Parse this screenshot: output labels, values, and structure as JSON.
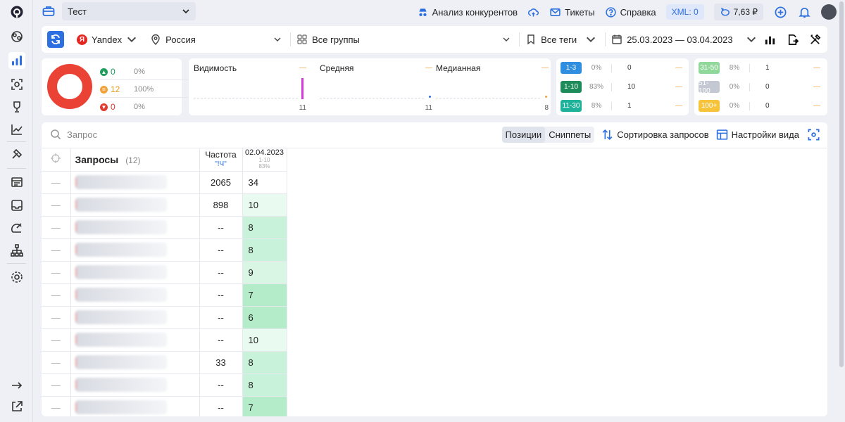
{
  "topbar": {
    "project": "Тест",
    "links": {
      "competitors": "Анализ конкурентов",
      "tickets": "Тикеты",
      "help": "Справка"
    },
    "xml": "XML: 0",
    "balance": "7,63 ₽"
  },
  "filters": {
    "engine": "Yandex",
    "region": "Россия",
    "groups": "Все группы",
    "tags": "Все теги",
    "date_range": "25.03.2023 — 03.04.2023"
  },
  "summary": {
    "up": {
      "count": "0",
      "pct": "0%"
    },
    "same": {
      "count": "12",
      "pct": "100%"
    },
    "down": {
      "count": "0",
      "pct": "0%"
    }
  },
  "metrics": [
    {
      "title": "Видимость",
      "delta": "—",
      "value": "11"
    },
    {
      "title": "Средняя",
      "delta": "—",
      "value": "11"
    },
    {
      "title": "Медианная",
      "delta": "—",
      "value": "8"
    }
  ],
  "ranges_left": [
    {
      "label": "1-3",
      "pct": "0%",
      "count": "0",
      "delta": "—",
      "color": "#2f8ee0"
    },
    {
      "label": "1-10",
      "pct": "83%",
      "count": "10",
      "delta": "—",
      "color": "#1d8c5a"
    },
    {
      "label": "11-30",
      "pct": "8%",
      "count": "1",
      "delta": "—",
      "color": "#1fb29a"
    }
  ],
  "ranges_right": [
    {
      "label": "31-50",
      "pct": "8%",
      "count": "1",
      "delta": "—",
      "color": "#8fd89a"
    },
    {
      "label": "51-100",
      "pct": "0%",
      "count": "0",
      "delta": "—",
      "color": "#c3c8d2"
    },
    {
      "label": "100+",
      "pct": "0%",
      "count": "0",
      "delta": "—",
      "color": "#f6c33b"
    }
  ],
  "main": {
    "search_placeholder": "Запрос",
    "seg_positions": "Позиции",
    "seg_snippets": "Сниппеты",
    "sort": "Сортировка запросов",
    "view": "Настройки вида",
    "col_queries": "Запросы",
    "query_count": "(12)",
    "col_freq": "Частота",
    "col_freq_sub": "\"!Ч\"",
    "col_date": "02.04.2023",
    "col_date_range": "1-10",
    "col_date_pct": "83%",
    "rows": [
      {
        "dash": "—",
        "freq": "2065",
        "pos": "34"
      },
      {
        "dash": "—",
        "freq": "898",
        "pos": "10"
      },
      {
        "dash": "—",
        "freq": "--",
        "pos": "8"
      },
      {
        "dash": "—",
        "freq": "--",
        "pos": "8"
      },
      {
        "dash": "—",
        "freq": "--",
        "pos": "9"
      },
      {
        "dash": "—",
        "freq": "--",
        "pos": "7"
      },
      {
        "dash": "—",
        "freq": "--",
        "pos": "6"
      },
      {
        "dash": "—",
        "freq": "--",
        "pos": "10"
      },
      {
        "dash": "—",
        "freq": "33",
        "pos": "8"
      },
      {
        "dash": "—",
        "freq": "--",
        "pos": "8"
      },
      {
        "dash": "—",
        "freq": "--",
        "pos": "7"
      }
    ]
  }
}
